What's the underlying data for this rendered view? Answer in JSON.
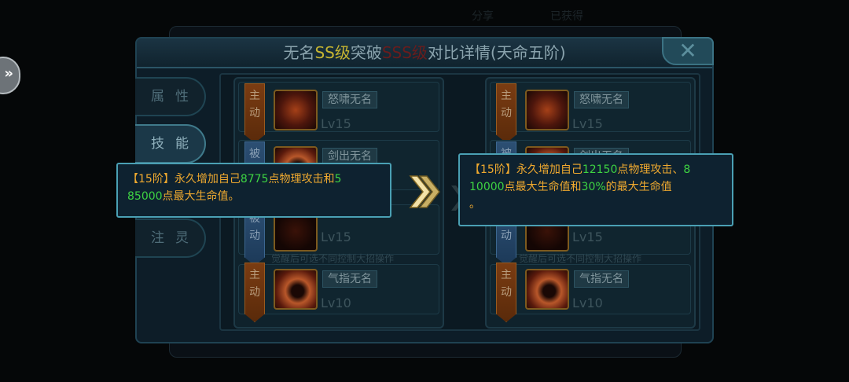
{
  "background": {
    "texts": [
      "分享",
      "已获得"
    ]
  },
  "dialog": {
    "title_prefix": "无名",
    "title_ss": "SS级",
    "title_mid": "突破",
    "title_sss": "SSS级",
    "title_suffix": "对比详情(天命五阶)",
    "close_icon": "close-x-icon"
  },
  "tabs": [
    {
      "label": "属性",
      "active": false
    },
    {
      "label": "技能",
      "active": true
    },
    {
      "label": "注灵",
      "active": false
    }
  ],
  "left_column": {
    "skills": [
      {
        "type": "主动",
        "name": "怒啸无名",
        "level": "Lv15",
        "icon": "fire-burst-icon"
      },
      {
        "type": "被动",
        "name": "剑出无名",
        "level": "Lv15",
        "icon": "sword-swirl-icon"
      },
      {
        "type": "被动",
        "name": "",
        "level": "Lv15",
        "icon": "dark-flame-icon"
      },
      {
        "type": "主动",
        "name": "气指无名",
        "level": "Lv10",
        "icon": "swirl-icon"
      }
    ],
    "note": "觉醒后可选不同控制大招操作"
  },
  "right_column": {
    "skills": [
      {
        "type": "主动",
        "name": "怒啸无名",
        "level": "Lv15",
        "icon": "fire-burst-icon"
      },
      {
        "type": "被动",
        "name": "剑出无名",
        "level": "Lv15",
        "icon": "sword-swirl-icon"
      },
      {
        "type": "被动",
        "name": "",
        "level": "Lv15",
        "icon": "dark-flame-icon"
      },
      {
        "type": "主动",
        "name": "气指无名",
        "level": "Lv10",
        "icon": "swirl-icon"
      }
    ],
    "note": "觉醒后可选不同控制大招操作"
  },
  "tooltip_left": {
    "p1": "【15阶】永久增加自己",
    "v1": "8775",
    "p2": "点物理攻击和",
    "v2a": "5",
    "v2b": "85000",
    "p3": "点最大生命值。"
  },
  "tooltip_right": {
    "p1": "【15阶】永久增加自己",
    "v1": "12150",
    "p2": "点物理攻击、",
    "v2a": "8",
    "v2b": "10000",
    "p3": "点最大生命值和",
    "v3": "30%",
    "p4": "的最大生命值",
    "p5": "。"
  },
  "compare_arrow_icon": "double-chevron-right-icon",
  "side_button_icon": "double-chevron-right-icon",
  "colors": {
    "highlight_orange": "#efa92f",
    "highlight_green": "#3ed442",
    "tooltip_border": "#4aa0b4",
    "panel_bg": "#0d1d28"
  }
}
